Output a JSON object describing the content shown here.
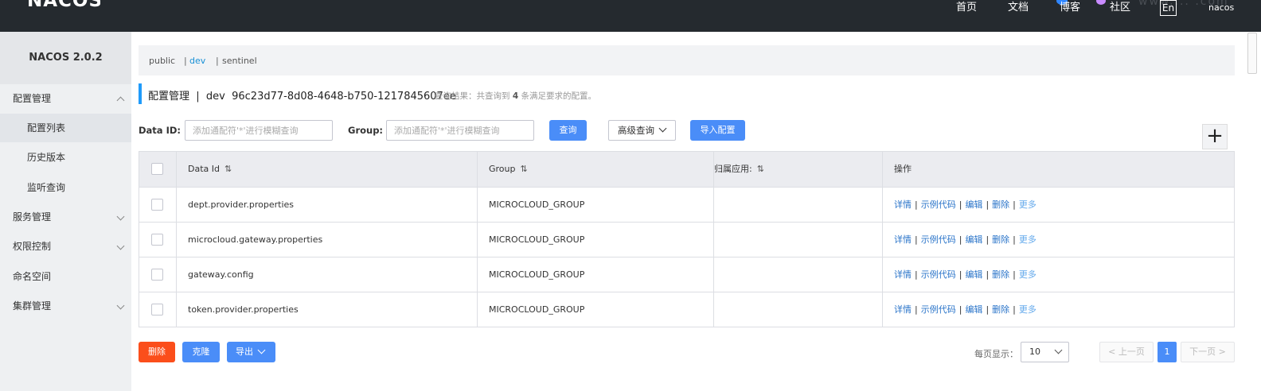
{
  "header": {
    "logo": "NACOS.",
    "nav": {
      "home": "首页",
      "docs": "文档",
      "blog": "博客",
      "community": "社区"
    },
    "lang_button": "En",
    "user": "nacos",
    "watermark": "www.... .com"
  },
  "sidebar": {
    "title": "NACOS 2.0.2",
    "items": [
      {
        "label": "配置管理",
        "expanded": true
      },
      {
        "label": "配置列表"
      },
      {
        "label": "历史版本"
      },
      {
        "label": "监听查询"
      },
      {
        "label": "服务管理",
        "expanded": false
      },
      {
        "label": "权限控制",
        "expanded": false
      },
      {
        "label": "命名空间"
      },
      {
        "label": "集群管理",
        "expanded": false
      }
    ]
  },
  "namespaces": {
    "items": [
      "public",
      "dev",
      "sentinel"
    ],
    "separator": "|",
    "active": "dev"
  },
  "page": {
    "title": "配置管理  |  dev  96c23d77-8d08-4648-b750-1217845607ee",
    "query_prefix": "查询结果：共查询到 ",
    "query_count": "4",
    "query_suffix": " 条满足要求的配置。"
  },
  "filters": {
    "data_id_label": "Data ID:",
    "data_id_placeholder": "添加通配符'*'进行模糊查询",
    "group_label": "Group:",
    "group_placeholder": "添加通配符'*'进行模糊查询",
    "search_button": "查询",
    "advanced_button": "高级查询",
    "import_button": "导入配置",
    "add_icon": "plus-icon"
  },
  "table": {
    "headers": {
      "data_id": "Data Id",
      "group": "Group",
      "app": "归属应用:",
      "ops": "操作",
      "sort_symbol": "⇅"
    },
    "rows": [
      {
        "data_id": "dept.provider.properties",
        "group": "MICROCLOUD_GROUP",
        "app": ""
      },
      {
        "data_id": "microcloud.gateway.properties",
        "group": "MICROCLOUD_GROUP",
        "app": ""
      },
      {
        "data_id": "gateway.config",
        "group": "MICROCLOUD_GROUP",
        "app": ""
      },
      {
        "data_id": "token.provider.properties",
        "group": "MICROCLOUD_GROUP",
        "app": ""
      }
    ],
    "ops": {
      "detail": "详情",
      "sample": "示例代码",
      "edit": "编辑",
      "delete": "删除",
      "more": "更多",
      "sep": "|"
    }
  },
  "footer": {
    "delete_button": "删除",
    "clone_button": "克隆",
    "export_button": "导出",
    "page_size_label": "每页显示：",
    "page_size": "10",
    "prev": "< 上一页",
    "current_page": "1",
    "next": "下一页 >"
  },
  "colors": {
    "header_bg": "#252a2f",
    "primary": "#4a8df8",
    "danger": "#fb4e1b",
    "link": "#2a74c9",
    "sidebar_bg": "#eef0f2"
  }
}
